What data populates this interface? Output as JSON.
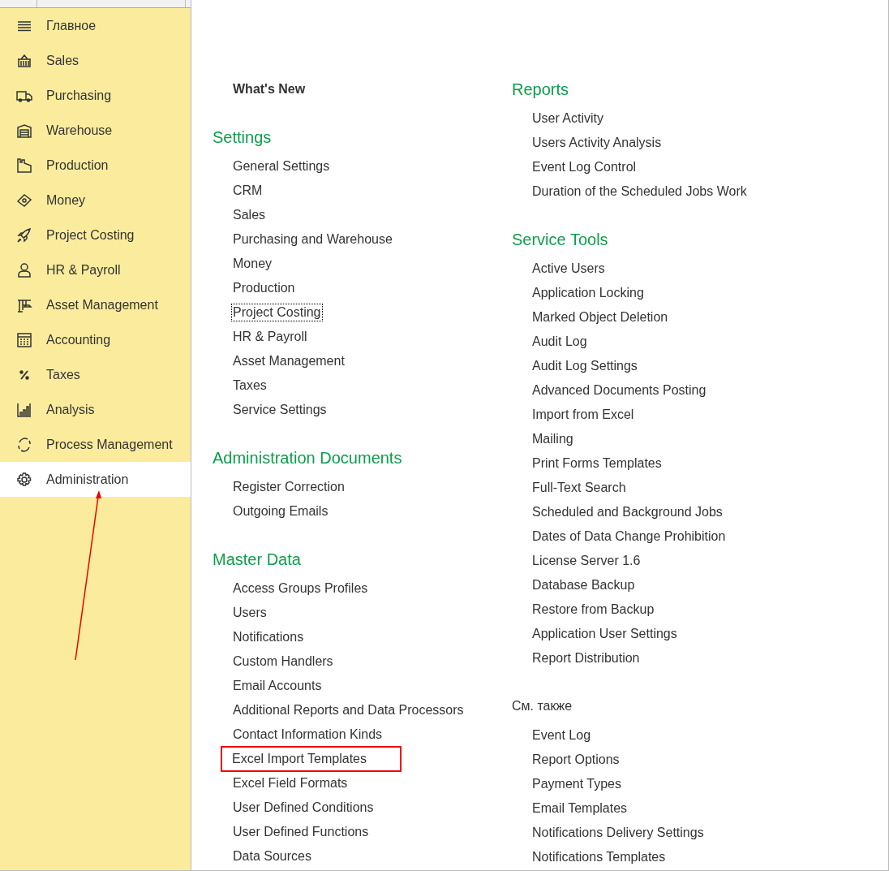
{
  "sidebar": {
    "items": [
      {
        "label": "Главное",
        "selected": false
      },
      {
        "label": "Sales",
        "selected": false
      },
      {
        "label": "Purchasing",
        "selected": false
      },
      {
        "label": "Warehouse",
        "selected": false
      },
      {
        "label": "Production",
        "selected": false
      },
      {
        "label": "Money",
        "selected": false
      },
      {
        "label": "Project Costing",
        "selected": false
      },
      {
        "label": "HR & Payroll",
        "selected": false
      },
      {
        "label": "Asset Management",
        "selected": false
      },
      {
        "label": "Accounting",
        "selected": false
      },
      {
        "label": "Taxes",
        "selected": false
      },
      {
        "label": "Analysis",
        "selected": false
      },
      {
        "label": "Process Management",
        "selected": false
      },
      {
        "label": "Administration",
        "selected": true
      }
    ]
  },
  "annotation": {
    "kind": "arrow"
  },
  "columns": [
    {
      "sections": [
        {
          "kind": "link",
          "title": "What's New"
        },
        {
          "kind": "group",
          "title": "Settings",
          "items": [
            {
              "label": "General Settings",
              "focused": false,
              "highlighted": false
            },
            {
              "label": "CRM",
              "focused": false,
              "highlighted": false
            },
            {
              "label": "Sales",
              "focused": false,
              "highlighted": false
            },
            {
              "label": "Purchasing and Warehouse",
              "focused": false,
              "highlighted": false
            },
            {
              "label": "Money",
              "focused": false,
              "highlighted": false
            },
            {
              "label": "Production",
              "focused": false,
              "highlighted": false
            },
            {
              "label": "Project Costing",
              "focused": true,
              "highlighted": false
            },
            {
              "label": "HR & Payroll",
              "focused": false,
              "highlighted": false
            },
            {
              "label": "Asset Management",
              "focused": false,
              "highlighted": false
            },
            {
              "label": "Taxes",
              "focused": false,
              "highlighted": false
            },
            {
              "label": "Service Settings",
              "focused": false,
              "highlighted": false
            }
          ]
        },
        {
          "kind": "group",
          "title": "Administration Documents",
          "items": [
            {
              "label": "Register Correction",
              "focused": false,
              "highlighted": false
            },
            {
              "label": "Outgoing Emails",
              "focused": false,
              "highlighted": false
            }
          ]
        },
        {
          "kind": "group",
          "title": "Master Data",
          "items": [
            {
              "label": "Access Groups Profiles",
              "focused": false,
              "highlighted": false
            },
            {
              "label": "Users",
              "focused": false,
              "highlighted": false
            },
            {
              "label": "Notifications",
              "focused": false,
              "highlighted": false
            },
            {
              "label": "Custom Handlers",
              "focused": false,
              "highlighted": false
            },
            {
              "label": "Email Accounts",
              "focused": false,
              "highlighted": false
            },
            {
              "label": "Additional Reports and Data Processors",
              "focused": false,
              "highlighted": false
            },
            {
              "label": "Contact Information Kinds",
              "focused": false,
              "highlighted": false
            },
            {
              "label": "Excel Import Templates",
              "focused": false,
              "highlighted": true
            },
            {
              "label": "Excel Field Formats",
              "focused": false,
              "highlighted": false
            },
            {
              "label": "User Defined Conditions",
              "focused": false,
              "highlighted": false
            },
            {
              "label": "User Defined Functions",
              "focused": false,
              "highlighted": false
            },
            {
              "label": "Data Sources",
              "focused": false,
              "highlighted": false
            }
          ]
        }
      ]
    },
    {
      "sections": [
        {
          "kind": "group",
          "title": "Reports",
          "items": [
            {
              "label": "User Activity",
              "focused": false,
              "highlighted": false
            },
            {
              "label": "Users Activity Analysis",
              "focused": false,
              "highlighted": false
            },
            {
              "label": "Event Log Control",
              "focused": false,
              "highlighted": false
            },
            {
              "label": "Duration of the Scheduled Jobs Work",
              "focused": false,
              "highlighted": false
            }
          ]
        },
        {
          "kind": "group",
          "title": "Service Tools",
          "items": [
            {
              "label": "Active Users",
              "focused": false,
              "highlighted": false
            },
            {
              "label": "Application Locking",
              "focused": false,
              "highlighted": false
            },
            {
              "label": "Marked Object Deletion",
              "focused": false,
              "highlighted": false
            },
            {
              "label": "Audit Log",
              "focused": false,
              "highlighted": false
            },
            {
              "label": "Audit Log Settings",
              "focused": false,
              "highlighted": false
            },
            {
              "label": "Advanced Documents Posting",
              "focused": false,
              "highlighted": false
            },
            {
              "label": "Import from Excel",
              "focused": false,
              "highlighted": false
            },
            {
              "label": "Mailing",
              "focused": false,
              "highlighted": false
            },
            {
              "label": "Print Forms Templates",
              "focused": false,
              "highlighted": false
            },
            {
              "label": "Full-Text Search",
              "focused": false,
              "highlighted": false
            },
            {
              "label": "Scheduled and Background Jobs",
              "focused": false,
              "highlighted": false
            },
            {
              "label": "Dates of Data Change Prohibition",
              "focused": false,
              "highlighted": false
            },
            {
              "label": "License Server 1.6",
              "focused": false,
              "highlighted": false
            },
            {
              "label": "Database Backup",
              "focused": false,
              "highlighted": false
            },
            {
              "label": "Restore from Backup",
              "focused": false,
              "highlighted": false
            },
            {
              "label": "Application User Settings",
              "focused": false,
              "highlighted": false
            },
            {
              "label": "Report Distribution",
              "focused": false,
              "highlighted": false
            }
          ]
        },
        {
          "kind": "see-also",
          "title": "См. также",
          "items": [
            {
              "label": "Event Log",
              "focused": false,
              "highlighted": false
            },
            {
              "label": "Report Options",
              "focused": false,
              "highlighted": false
            },
            {
              "label": "Payment Types",
              "focused": false,
              "highlighted": false
            },
            {
              "label": "Email Templates",
              "focused": false,
              "highlighted": false
            },
            {
              "label": "Notifications Delivery Settings",
              "focused": false,
              "highlighted": false
            },
            {
              "label": "Notifications Templates",
              "focused": false,
              "highlighted": false
            }
          ]
        }
      ]
    }
  ]
}
